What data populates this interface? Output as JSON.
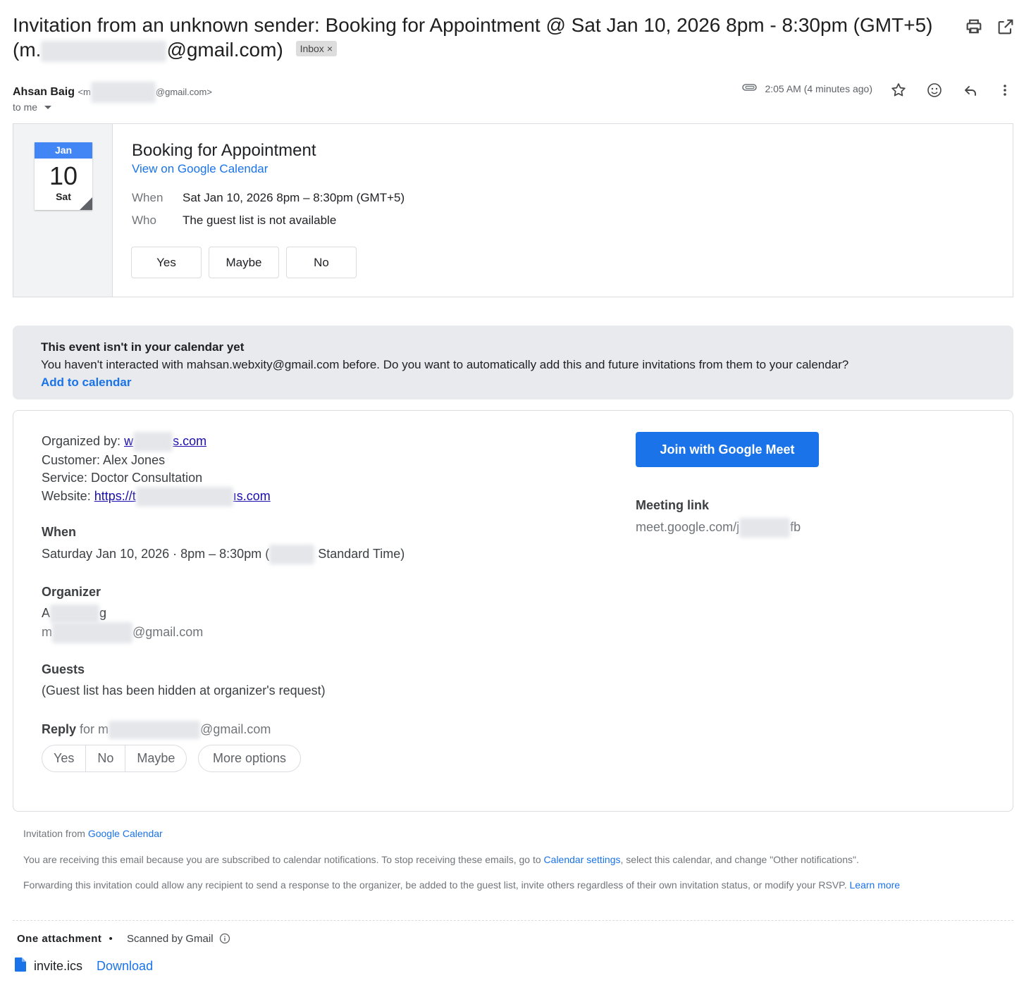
{
  "subject": {
    "prefix": "Invitation from an unknown sender: Booking for Appointment @ Sat Jan 10, 2026 8pm - 8:30pm (GMT+5)",
    "email_start": "(m.",
    "email_end": "@gmail.com)",
    "label_chip": "Inbox",
    "chip_close": "×"
  },
  "header": {
    "sender_name": "Ahsan Baig",
    "sender_email_start": "<m",
    "sender_email_end": "@gmail.com>",
    "recipient": "to me",
    "time": "2:05 AM (4 minutes ago)"
  },
  "icons": {
    "print": "print-icon",
    "popout": "open-in-new-window-icon",
    "attachment": "paperclip-icon",
    "star": "star-icon",
    "emoji": "emoji-reaction-icon",
    "reply": "reply-icon",
    "more": "more-vertical-icon",
    "info": "info-icon",
    "file": "file-icon"
  },
  "event_card": {
    "month": "Jan",
    "day": "10",
    "weekday": "Sat",
    "title": "Booking for Appointment",
    "calendar_link": "View on Google Calendar",
    "when_label": "When",
    "when_value": "Sat Jan 10, 2026 8pm – 8:30pm (GMT+5)",
    "who_label": "Who",
    "who_value": "The guest list is not available",
    "rsvp": [
      "Yes",
      "Maybe",
      "No"
    ]
  },
  "banner": {
    "title": "This event isn't in your calendar yet",
    "message": "You haven't interacted with mahsan.webxity@gmail.com before. Do you want to automatically add this and future invitations from them to your calendar?",
    "action": "Add to calendar"
  },
  "details": {
    "organized_by_label": "Organized by: ",
    "organized_by_start": "w",
    "organized_by_end": "s.com",
    "customer": "Customer: Alex Jones",
    "service": "Service: Doctor Consultation",
    "website_label": "Website: ",
    "website_start": "https://t",
    "website_end": "ıs.com",
    "when_heading": "When",
    "when_start": "Saturday Jan 10, 2026 · 8pm – 8:30pm (",
    "when_end": "Standard Time)",
    "organizer_heading": "Organizer",
    "organizer_name_start": "A",
    "organizer_name_end": "g",
    "organizer_email_start": "m",
    "organizer_email_end": "@gmail.com",
    "guests_heading": "Guests",
    "guests_text": "(Guest list has been hidden at organizer's request)",
    "reply_heading": "Reply",
    "reply_for_start": " for m",
    "reply_for_end": "@gmail.com",
    "reply_options": [
      "Yes",
      "No",
      "Maybe"
    ],
    "more_options": "More options",
    "meet_button": "Join with Google Meet",
    "meeting_link_heading": "Meeting link",
    "meeting_link_start": "meet.google.com/j",
    "meeting_link_end": "fb"
  },
  "footer": {
    "invitation_from": "Invitation from ",
    "invitation_link": "Google Calendar",
    "receiving_start": "You are receiving this email because you are subscribed to calendar notifications. To stop receiving these emails, go to ",
    "receiving_link": "Calendar settings",
    "receiving_end": ", select this calendar, and change \"Other notifications\".",
    "forwarding": "Forwarding this invitation could allow any recipient to send a response to the organizer, be added to the guest list, invite others regardless of their own invitation status, or modify your RSVP. ",
    "learn_more": "Learn more"
  },
  "attachments": {
    "heading": "One attachment",
    "separator": "•",
    "scanned": "Scanned by Gmail",
    "file_name": "invite.ics",
    "download": "Download"
  },
  "colors": {
    "link_blue": "#1a73e8",
    "calendar_blue": "#4285f4",
    "banner_bg": "#e8eaed"
  }
}
